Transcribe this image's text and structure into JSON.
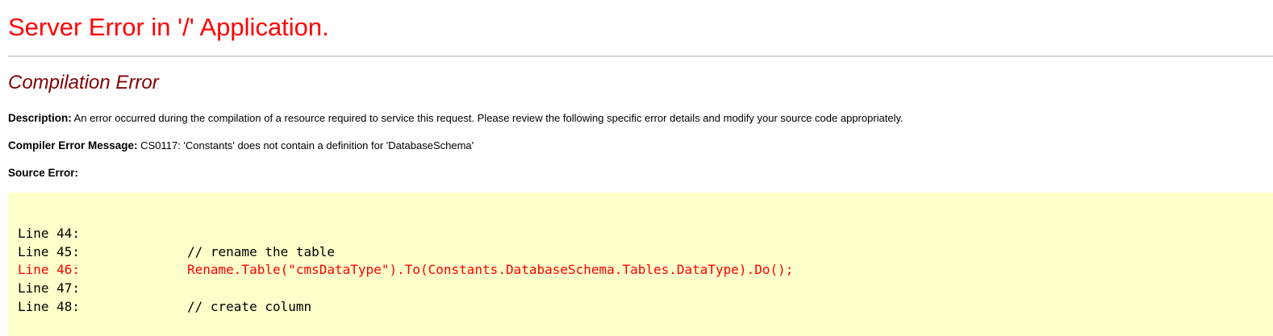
{
  "page": {
    "title": "Server Error in '/' Application.",
    "subtitle": "Compilation Error"
  },
  "description": {
    "label": "Description:",
    "text": " An error occurred during the compilation of a resource required to service this request. Please review the following specific error details and modify your source code appropriately."
  },
  "compiler_message": {
    "label": "Compiler Error Message:",
    "text": " CS0117: 'Constants' does not contain a definition for 'DatabaseSchema'"
  },
  "source_error": {
    "label": "Source Error:",
    "lines": [
      {
        "number": "Line 44:",
        "code": "",
        "highlighted": false
      },
      {
        "number": "Line 45:",
        "code": "// rename the table",
        "highlighted": false
      },
      {
        "number": "Line 46:",
        "code": "Rename.Table(\"cmsDataType\").To(Constants.DatabaseSchema.Tables.DataType).Do();",
        "highlighted": true
      },
      {
        "number": "Line 47:",
        "code": "",
        "highlighted": false
      },
      {
        "number": "Line 48:",
        "code": "// create column",
        "highlighted": false
      }
    ]
  },
  "colors": {
    "title": "#ff0000",
    "subtitle": "#800000",
    "code_background": "#ffffcc",
    "error_line": "#ff0000"
  }
}
